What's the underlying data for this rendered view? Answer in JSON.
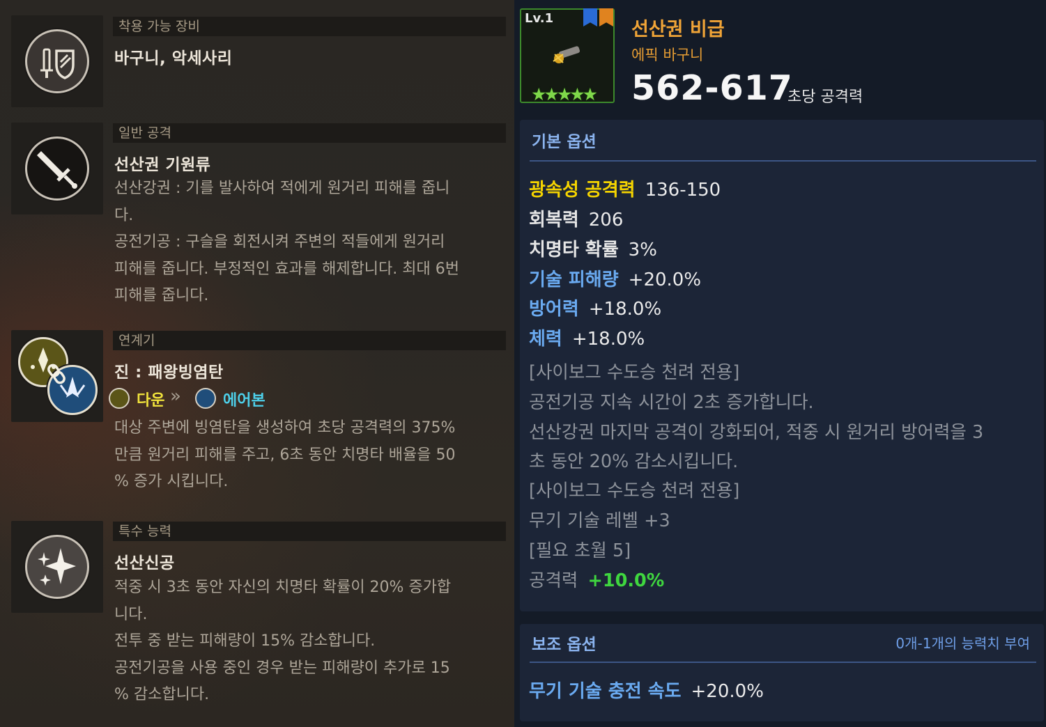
{
  "left": {
    "equip": {
      "header": "착용 가능 장비",
      "title": "바구니, 악세사리",
      "icon": "sword-shield-icon"
    },
    "normal_attack": {
      "header": "일반 공격",
      "title": "선산권 기원류",
      "desc": [
        "선산강권 : 기를 발사하여 적에게 원거리 피해를 줍니",
        "다.",
        "공전기공 : 구슬을 회전시켜 주변의 적들에게 원거리",
        "피해를 줍니다. 부정적인 효과를 해제합니다. 최대 6번",
        "피해를 줍니다."
      ],
      "icon": "sword-icon"
    },
    "combo": {
      "header": "연계기",
      "title": "진 : 패왕빙염탄",
      "from": "다운",
      "arrow": "»",
      "to": "에어본",
      "desc": [
        "대상 주변에 빙염탄을 생성하여 초당 공격력의 375%",
        "만큼 원거리 피해를 주고, 6초 동안 치명타 배율을 50",
        "% 증가 시킵니다."
      ],
      "icon": "chain-link-icon"
    },
    "special": {
      "header": "특수 능력",
      "title": "선산신공",
      "desc": [
        "적중 시 3초 동안 자신의 치명타 확률이 20% 증가합",
        "니다.",
        "전투 중 받는 피해량이 15% 감소합니다.",
        "공전기공을 사용 중인 경우 받는 피해량이 추가로 15",
        "% 감소합니다."
      ],
      "icon": "sparkle-icon"
    }
  },
  "item": {
    "level": "Lv.1",
    "stars": "★★★★★",
    "name": "선산권 비급",
    "type": "에픽 바구니",
    "attack": "562-617",
    "attack_label": "초당 공격력",
    "colors": {
      "name": "#f0a437",
      "rarity_border": "#3d8a2c"
    }
  },
  "basic": {
    "header": "기본 옵션",
    "stats": [
      {
        "label": "광속성 공격력",
        "value": "136-150",
        "color": "#f5d400"
      },
      {
        "label": "회복력",
        "value": "206",
        "color": "#e6e6e6"
      },
      {
        "label": "치명타 확률",
        "value": "3%",
        "color": "#e6e6e6"
      },
      {
        "label": "기술 피해량",
        "value": "+20.0%",
        "color": "#6aaaf0"
      },
      {
        "label": "방어력",
        "value": "+18.0%",
        "color": "#6aaaf0"
      },
      {
        "label": "체력",
        "value": "+18.0%",
        "color": "#6aaaf0"
      }
    ],
    "notes": [
      "[사이보그 수도승 천려 전용]",
      "공전기공 지속 시간이 2초 증가합니다.",
      "선산강권 마지막 공격이 강화되어, 적중 시 원거리 방어력을 3",
      "초 동안 20% 감소시킵니다.",
      "[사이보그 수도승 천려 전용]",
      "무기 기술 레벨 +3",
      "[필요 초월 5]"
    ],
    "last": {
      "label": "공격력",
      "value": "+10.0%",
      "value_color": "#3fd63f"
    }
  },
  "sub": {
    "header": "보조 옵션",
    "note": "0개-1개의 능력치 부여",
    "stat": {
      "label": "무기 기술 충전 속도",
      "value": "+20.0%",
      "color": "#6aaaf0"
    }
  }
}
